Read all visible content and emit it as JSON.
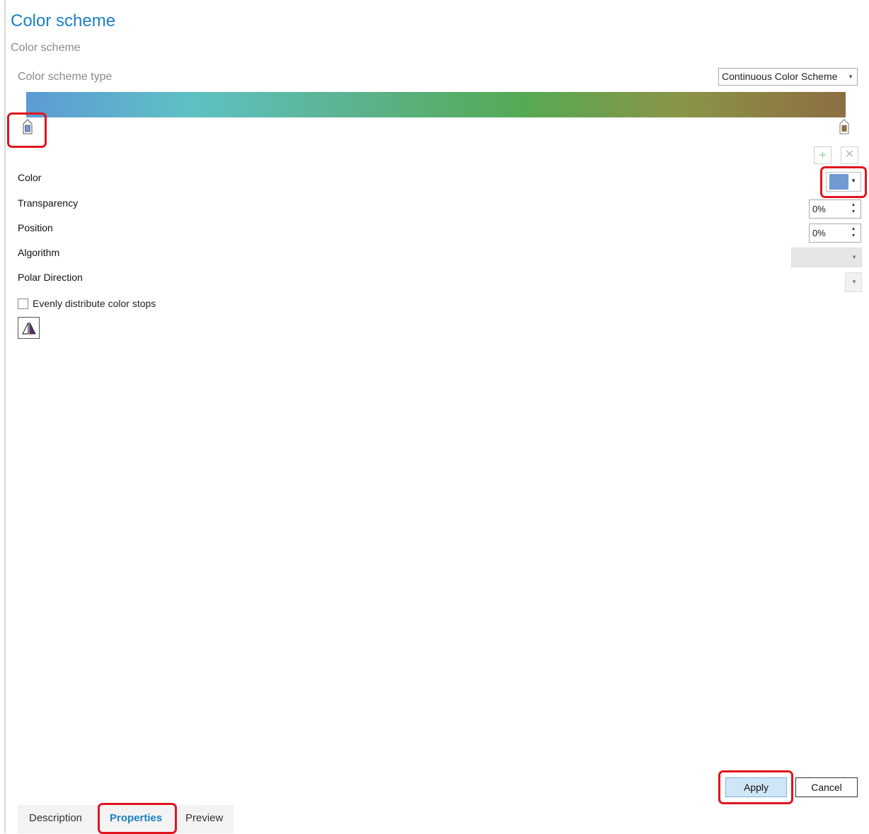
{
  "header": {
    "title": "Color scheme",
    "subtitle": "Color scheme"
  },
  "scheme": {
    "type_label": "Color scheme type",
    "type_value": "Continuous Color Scheme",
    "ramp_colors": [
      "#5b9bd5",
      "#5fc0c4",
      "#5bb38e",
      "#54aa55",
      "#8a9446",
      "#8d6e43"
    ],
    "stops": [
      {
        "name": "left",
        "color": "#6f9ad2"
      },
      {
        "name": "right",
        "color": "#8d6e43"
      }
    ]
  },
  "properties": {
    "color_label": "Color",
    "color_value": "#6f9ad2",
    "transparency_label": "Transparency",
    "transparency_value": "0%",
    "position_label": "Position",
    "position_value": "0%",
    "algorithm_label": "Algorithm",
    "polar_label": "Polar Direction",
    "evenly_label": "Evenly distribute color stops"
  },
  "footer": {
    "apply_label": "Apply",
    "cancel_label": "Cancel"
  },
  "tabs": [
    {
      "label": "Description"
    },
    {
      "label": "Properties"
    },
    {
      "label": "Preview"
    }
  ],
  "colors": {
    "accent": "#1b7fc4",
    "highlight": "#e0141e"
  }
}
